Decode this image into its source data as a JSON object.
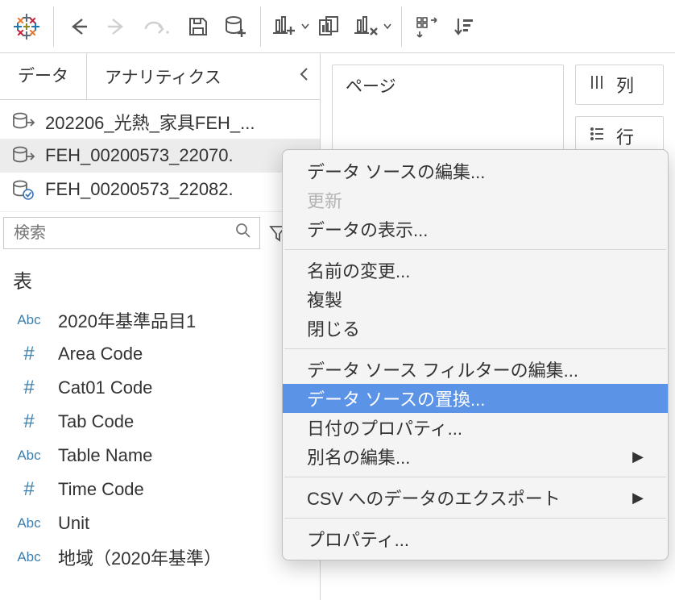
{
  "toolbar": {
    "logo": "tableau-logo"
  },
  "sidebar": {
    "tabs": {
      "data": "データ",
      "analytics": "アナリティクス"
    },
    "datasources": [
      {
        "label": "202206_光熱_家具FEH_...",
        "checked": false,
        "selected": false
      },
      {
        "label": "FEH_00200573_22070.",
        "checked": false,
        "selected": true
      },
      {
        "label": "FEH_00200573_22082.",
        "checked": true,
        "selected": false
      }
    ],
    "search_placeholder": "検索",
    "tables_heading": "表",
    "fields": [
      {
        "type": "Abc",
        "name": "2020年基準品目1"
      },
      {
        "type": "#",
        "name": "Area Code"
      },
      {
        "type": "#",
        "name": "Cat01 Code"
      },
      {
        "type": "#",
        "name": "Tab Code"
      },
      {
        "type": "Abc",
        "name": "Table Name"
      },
      {
        "type": "#",
        "name": "Time Code"
      },
      {
        "type": "Abc",
        "name": "Unit"
      },
      {
        "type": "Abc",
        "name": "地域（2020年基準）"
      }
    ]
  },
  "shelves": {
    "pages": "ページ",
    "columns": "列",
    "rows": "行"
  },
  "context_menu": {
    "items": [
      {
        "label": "データ ソースの編集...",
        "enabled": true
      },
      {
        "label": "更新",
        "enabled": false
      },
      {
        "label": "データの表示...",
        "enabled": true
      },
      {
        "sep": true
      },
      {
        "label": "名前の変更...",
        "enabled": true
      },
      {
        "label": "複製",
        "enabled": true
      },
      {
        "label": "閉じる",
        "enabled": true
      },
      {
        "sep": true
      },
      {
        "label": "データ ソース フィルターの編集...",
        "enabled": true
      },
      {
        "label": "データ ソースの置換...",
        "enabled": true,
        "highlighted": true
      },
      {
        "label": "日付のプロパティ...",
        "enabled": true
      },
      {
        "label": "別名の編集...",
        "enabled": true,
        "submenu": true
      },
      {
        "sep": true
      },
      {
        "label": "CSV へのデータのエクスポート",
        "enabled": true,
        "submenu": true
      },
      {
        "sep": true
      },
      {
        "label": "プロパティ...",
        "enabled": true
      }
    ]
  }
}
